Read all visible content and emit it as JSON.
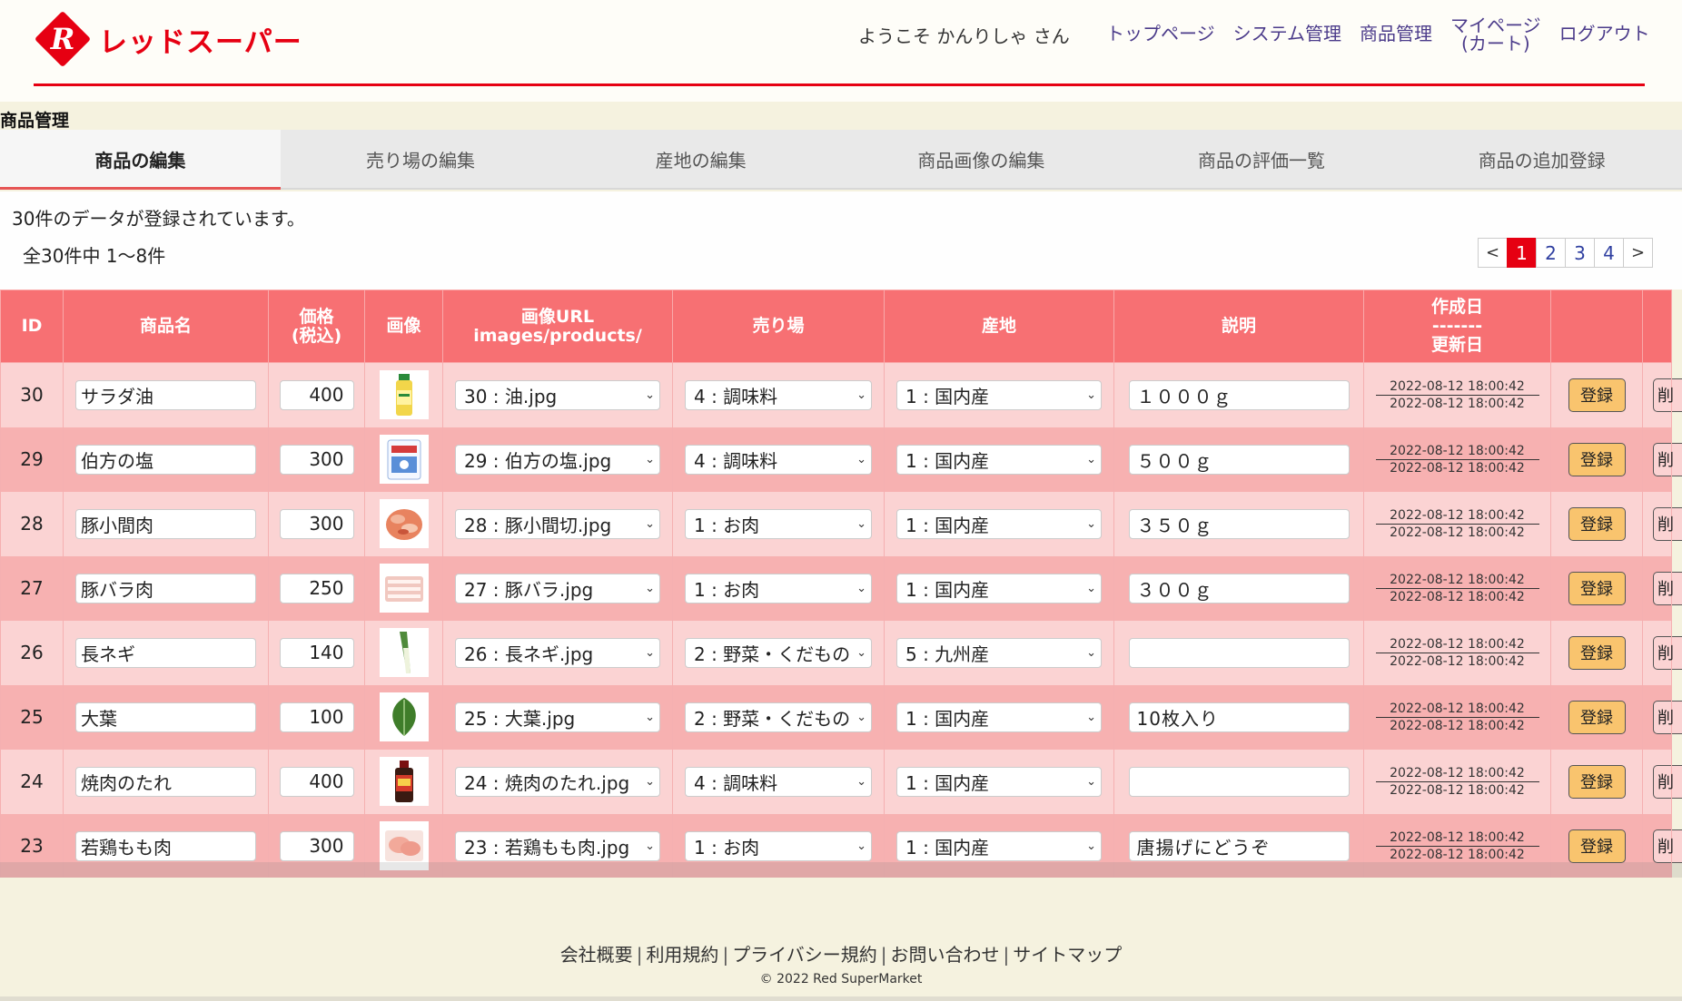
{
  "brand": {
    "name": "レッドスーパー",
    "mark_letter": "R",
    "color": "#e60012"
  },
  "header": {
    "welcome": "ようこそ かんりしゃ さん",
    "nav": [
      "トップページ",
      "システム管理",
      "商品管理"
    ],
    "nav_mypage_line1": "マイページ",
    "nav_mypage_line2": "(カート)",
    "nav_logout": "ログアウト"
  },
  "page_title": "商品管理",
  "tabs": [
    "商品の編集",
    "売り場の編集",
    "産地の編集",
    "商品画像の編集",
    "商品の評価一覧",
    "商品の追加登録"
  ],
  "summary": {
    "count_text": "30件のデータが登録されています。",
    "range_text": "全30件中 1〜8件"
  },
  "pagination": {
    "prev": "<",
    "pages": [
      "1",
      "2",
      "3",
      "4"
    ],
    "current": "1",
    "next": ">"
  },
  "table": {
    "headers": {
      "id": "ID",
      "name": "商品名",
      "price_l1": "価格",
      "price_l2": "(税込)",
      "image": "画像",
      "url_l1": "画像URL",
      "url_l2": "images/products/",
      "floor": "売り場",
      "origin": "産地",
      "desc": "説明",
      "date_l1": "作成日",
      "date_l2": "-------",
      "date_l3": "更新日"
    },
    "register_label": "登録",
    "delete_label": "削",
    "rows": [
      {
        "id": "30",
        "name": "サラダ油",
        "price": "400",
        "thumb": "oil-bottle",
        "url": "30 : 油.jpg",
        "floor": "4 : 調味料",
        "origin": "1 : 国内産",
        "desc": "１０００ｇ",
        "created": "2022-08-12 18:00:42",
        "updated": "2022-08-12 18:00:42"
      },
      {
        "id": "29",
        "name": "伯方の塩",
        "price": "300",
        "thumb": "salt-bag",
        "url": "29 : 伯方の塩.jpg",
        "floor": "4 : 調味料",
        "origin": "1 : 国内産",
        "desc": "５００ｇ",
        "created": "2022-08-12 18:00:42",
        "updated": "2022-08-12 18:00:42"
      },
      {
        "id": "28",
        "name": "豚小間肉",
        "price": "300",
        "thumb": "pork-pieces",
        "url": "28 : 豚小間切.jpg",
        "floor": "1 : お肉",
        "origin": "1 : 国内産",
        "desc": "３５０ｇ",
        "created": "2022-08-12 18:00:42",
        "updated": "2022-08-12 18:00:42"
      },
      {
        "id": "27",
        "name": "豚バラ肉",
        "price": "250",
        "thumb": "pork-belly",
        "url": "27 : 豚バラ.jpg",
        "floor": "1 : お肉",
        "origin": "1 : 国内産",
        "desc": "３００ｇ",
        "created": "2022-08-12 18:00:42",
        "updated": "2022-08-12 18:00:42"
      },
      {
        "id": "26",
        "name": "長ネギ",
        "price": "140",
        "thumb": "leek",
        "url": "26 : 長ネギ.jpg",
        "floor": "2 : 野菜・くだもの",
        "origin": "5 : 九州産",
        "desc": "",
        "created": "2022-08-12 18:00:42",
        "updated": "2022-08-12 18:00:42"
      },
      {
        "id": "25",
        "name": "大葉",
        "price": "100",
        "thumb": "shiso-leaf",
        "url": "25 : 大葉.jpg",
        "floor": "2 : 野菜・くだもの",
        "origin": "1 : 国内産",
        "desc": "10枚入り",
        "created": "2022-08-12 18:00:42",
        "updated": "2022-08-12 18:00:42"
      },
      {
        "id": "24",
        "name": "焼肉のたれ",
        "price": "400",
        "thumb": "sauce-bottle",
        "url": "24 : 焼肉のたれ.jpg",
        "floor": "4 : 調味料",
        "origin": "1 : 国内産",
        "desc": "",
        "created": "2022-08-12 18:00:42",
        "updated": "2022-08-12 18:00:42"
      },
      {
        "id": "23",
        "name": "若鶏もも肉",
        "price": "300",
        "thumb": "chicken-thigh",
        "url": "23 : 若鶏もも肉.jpg",
        "floor": "1 : お肉",
        "origin": "1 : 国内産",
        "desc": "唐揚げにどうぞ",
        "created": "2022-08-12 18:00:42",
        "updated": "2022-08-12 18:00:42"
      }
    ]
  },
  "footer": {
    "links": [
      "会社概要",
      "利用規約",
      "プライバシー規約",
      "お問い合わせ",
      "サイトマップ"
    ],
    "separator": "|",
    "copyright": "© 2022 Red SuperMarket"
  },
  "colors": {
    "header_row": "#f77073",
    "row_light": "#fbd3d3",
    "row_dark": "#f7b1b1",
    "register_button": "#f9c46e",
    "nav_link": "#4b3b8a",
    "active_page": "#e60012"
  }
}
